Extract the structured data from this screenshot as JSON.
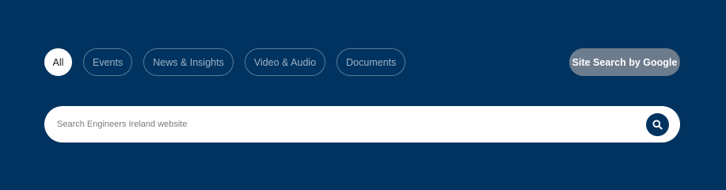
{
  "filters": {
    "items": [
      {
        "label": "All",
        "active": true
      },
      {
        "label": "Events",
        "active": false
      },
      {
        "label": "News & Insights",
        "active": false
      },
      {
        "label": "Video & Audio",
        "active": false
      },
      {
        "label": "Documents",
        "active": false
      }
    ]
  },
  "site_search": {
    "label": "Site Search by Google"
  },
  "search": {
    "placeholder": "Search Engineers Ireland website",
    "value": "",
    "icon": "search-icon"
  },
  "colors": {
    "background": "#003360",
    "active_pill": "#ffffff",
    "site_search_button": "#6d7c8d",
    "search_button": "#003360"
  }
}
